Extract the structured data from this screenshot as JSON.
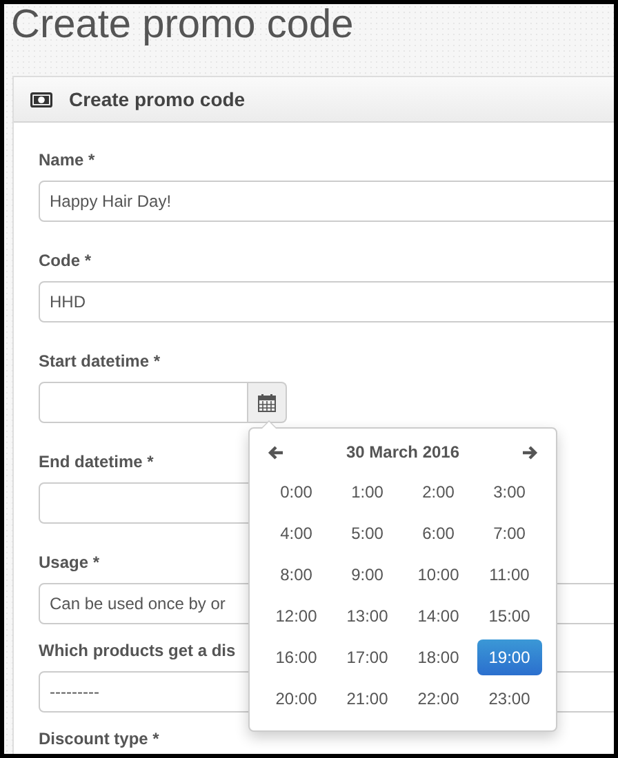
{
  "page_title": "Create promo code",
  "panel": {
    "title": "Create promo code"
  },
  "fields": [
    {
      "label": "Name *",
      "kind": "text",
      "value": "Happy Hair Day!"
    },
    {
      "label": "Code *",
      "kind": "text",
      "value": "HHD"
    },
    {
      "label": "Start datetime *",
      "kind": "datetime",
      "open": true
    },
    {
      "label": "End datetime *",
      "kind": "datetime",
      "open": false
    },
    {
      "label": "Usage *",
      "kind": "select",
      "value": "Can be used once by or"
    },
    {
      "label": "Which products get a dis",
      "kind": "select",
      "value": "---------"
    },
    {
      "label": "Discount type *",
      "kind": "label"
    }
  ],
  "picker": {
    "title": "30 March 2016",
    "hours": [
      {
        "label": "0:00",
        "selected": false
      },
      {
        "label": "1:00",
        "selected": false
      },
      {
        "label": "2:00",
        "selected": false
      },
      {
        "label": "3:00",
        "selected": false
      },
      {
        "label": "4:00",
        "selected": false
      },
      {
        "label": "5:00",
        "selected": false
      },
      {
        "label": "6:00",
        "selected": false
      },
      {
        "label": "7:00",
        "selected": false
      },
      {
        "label": "8:00",
        "selected": false
      },
      {
        "label": "9:00",
        "selected": false
      },
      {
        "label": "10:00",
        "selected": false
      },
      {
        "label": "11:00",
        "selected": false
      },
      {
        "label": "12:00",
        "selected": false
      },
      {
        "label": "13:00",
        "selected": false
      },
      {
        "label": "14:00",
        "selected": false
      },
      {
        "label": "15:00",
        "selected": false
      },
      {
        "label": "16:00",
        "selected": false
      },
      {
        "label": "17:00",
        "selected": false
      },
      {
        "label": "18:00",
        "selected": false
      },
      {
        "label": "19:00",
        "selected": true
      },
      {
        "label": "20:00",
        "selected": false
      },
      {
        "label": "21:00",
        "selected": false
      },
      {
        "label": "22:00",
        "selected": false
      },
      {
        "label": "23:00",
        "selected": false
      }
    ]
  }
}
